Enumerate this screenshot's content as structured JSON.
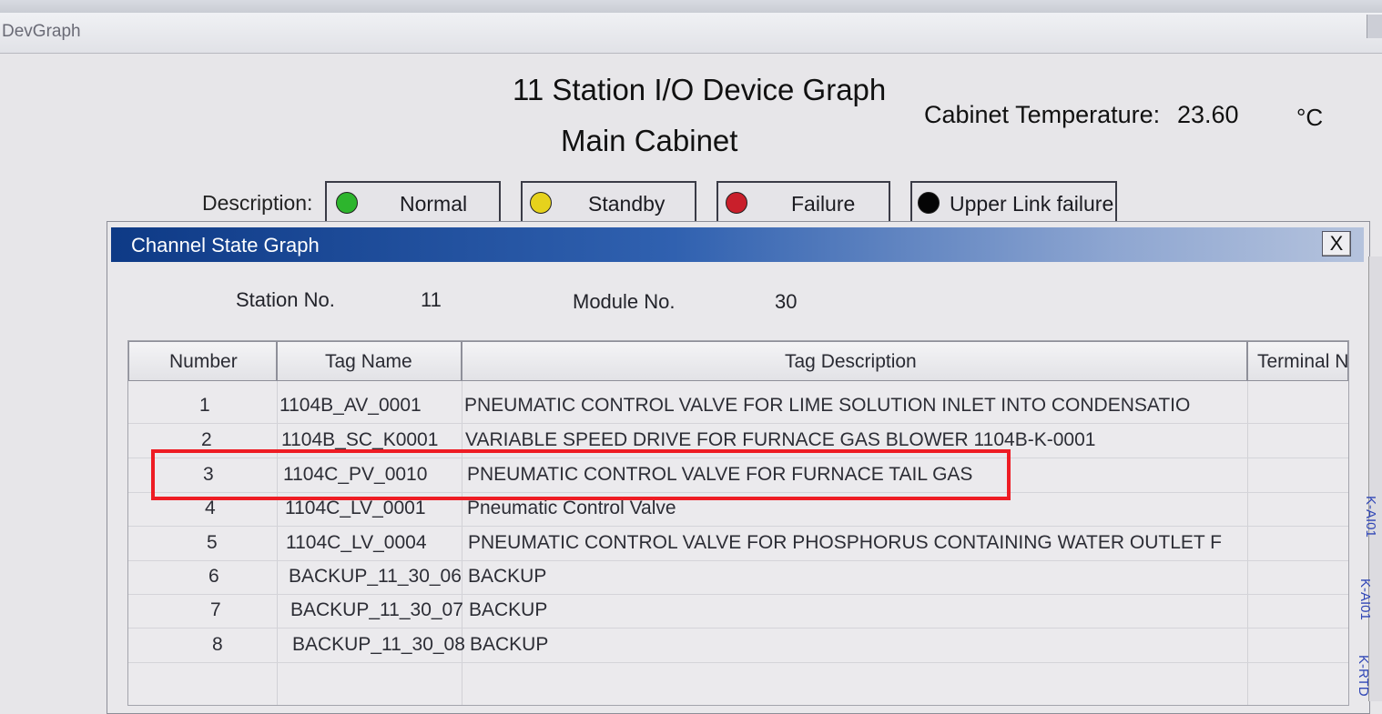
{
  "window": {
    "title": "DevGraph"
  },
  "header": {
    "title": "11 Station I/O Device Graph",
    "subtitle": "Main Cabinet",
    "temperature_label": "Cabinet Temperature:",
    "temperature_value": "23.60",
    "temperature_unit": "°C"
  },
  "legend": {
    "label": "Description:",
    "items": [
      {
        "label": "Normal",
        "color": "#2db52d",
        "icon": "green-status-dot-icon"
      },
      {
        "label": "Standby",
        "color": "#e6d21c",
        "icon": "yellow-status-dot-icon"
      },
      {
        "label": "Failure",
        "color": "#c91f2b",
        "icon": "red-status-dot-icon"
      },
      {
        "label": "Upper Link failure",
        "color": "#050505",
        "icon": "black-status-dot-icon"
      }
    ]
  },
  "dialog": {
    "title": "Channel State Graph",
    "close_label": "X",
    "station_label": "Station No.",
    "station_value": "11",
    "module_label": "Module No.",
    "module_value": "30",
    "columns": [
      "Number",
      "Tag Name",
      "Tag Description",
      "Terminal N"
    ],
    "rows": [
      {
        "number": "1",
        "tag": "1104B_AV_0001",
        "description": "PNEUMATIC CONTROL VALVE FOR LIME SOLUTION INLET INTO CONDENSATIO"
      },
      {
        "number": "2",
        "tag": "1104B_SC_K0001",
        "description": "VARIABLE SPEED DRIVE FOR FURNACE GAS BLOWER 1104B-K-0001"
      },
      {
        "number": "3",
        "tag": "1104C_PV_0010",
        "description": "PNEUMATIC CONTROL VALVE FOR FURNACE TAIL GAS"
      },
      {
        "number": "4",
        "tag": "1104C_LV_0001",
        "description": "Pneumatic Control Valve"
      },
      {
        "number": "5",
        "tag": "1104C_LV_0004",
        "description": "PNEUMATIC CONTROL VALVE FOR PHOSPHORUS CONTAINING WATER OUTLET F"
      },
      {
        "number": "6",
        "tag": "BACKUP_11_30_06",
        "description": "BACKUP"
      },
      {
        "number": "7",
        "tag": "BACKUP_11_30_07",
        "description": "BACKUP"
      },
      {
        "number": "8",
        "tag": "BACKUP_11_30_08",
        "description": "BACKUP"
      }
    ]
  },
  "side_labels": [
    "K-AI01",
    "K-AI01",
    "K-RTD"
  ],
  "colors": {
    "highlight": "#ee1c24",
    "dialog_title_bar": "#0e3a86",
    "side_label": "#3046b6"
  }
}
